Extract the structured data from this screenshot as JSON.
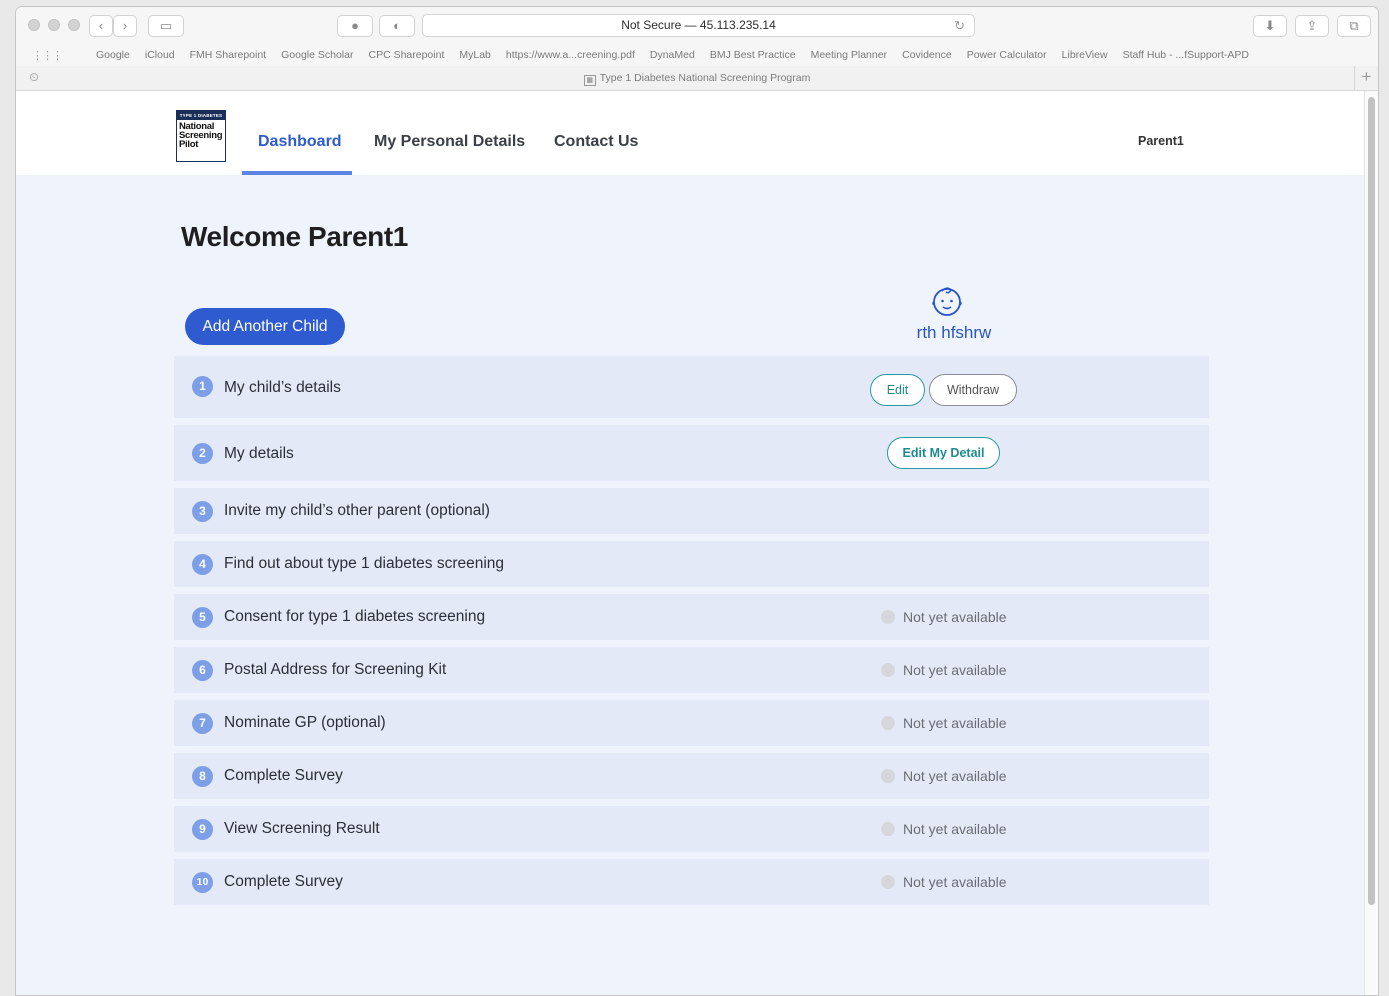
{
  "browser": {
    "url_text": "Not Secure — 45.113.235.14",
    "bookmarks": [
      "Google",
      "iCloud",
      "FMH Sharepoint",
      "Google Scholar",
      "CPC Sharepoint",
      "MyLab",
      "https://www.a...creening.pdf",
      "DynaMed",
      "BMJ Best Practice",
      "Meeting Planner",
      "Covidence",
      "Power Calculator",
      "LibreView",
      "Staff Hub - ...fSupport-APD"
    ],
    "tab_title": "Type 1 Diabetes National Screening Program"
  },
  "header": {
    "logo_band": "TYPE 1 DIABETES",
    "logo_lines": [
      "National",
      "Screening",
      "Pilot"
    ],
    "nav": [
      "Dashboard",
      "My Personal Details",
      "Contact Us"
    ],
    "active_nav": "Dashboard",
    "user": "Parent1"
  },
  "main": {
    "welcome": "Welcome Parent1",
    "add_child_label": "Add Another Child",
    "child_name": "rth hfshrw",
    "steps": [
      {
        "num": "1",
        "label": "My child’s details",
        "actions": [
          "Edit",
          "Withdraw"
        ]
      },
      {
        "num": "2",
        "label": "My details",
        "actions": [
          "Edit My Detail"
        ]
      },
      {
        "num": "3",
        "label": "Invite my child’s other parent (optional)"
      },
      {
        "num": "4",
        "label": "Find out about type 1 diabetes screening"
      },
      {
        "num": "5",
        "label": "Consent for type 1 diabetes screening",
        "status": "Not yet available"
      },
      {
        "num": "6",
        "label": "Postal Address for Screening Kit",
        "status": "Not yet available"
      },
      {
        "num": "7",
        "label": "Nominate GP (optional)",
        "status": "Not yet available"
      },
      {
        "num": "8",
        "label": "Complete Survey",
        "status": "Not yet available"
      },
      {
        "num": "9",
        "label": "View Screening Result",
        "status": "Not yet available"
      },
      {
        "num": "10",
        "label": "Complete Survey",
        "status": "Not yet available"
      }
    ]
  },
  "colors": {
    "primary": "#2f5bd0",
    "step_bg": "#e3e9f7",
    "step_badge": "#7c9fe8",
    "page_bg": "#eff3fb",
    "teal": "#2a9aa0"
  }
}
